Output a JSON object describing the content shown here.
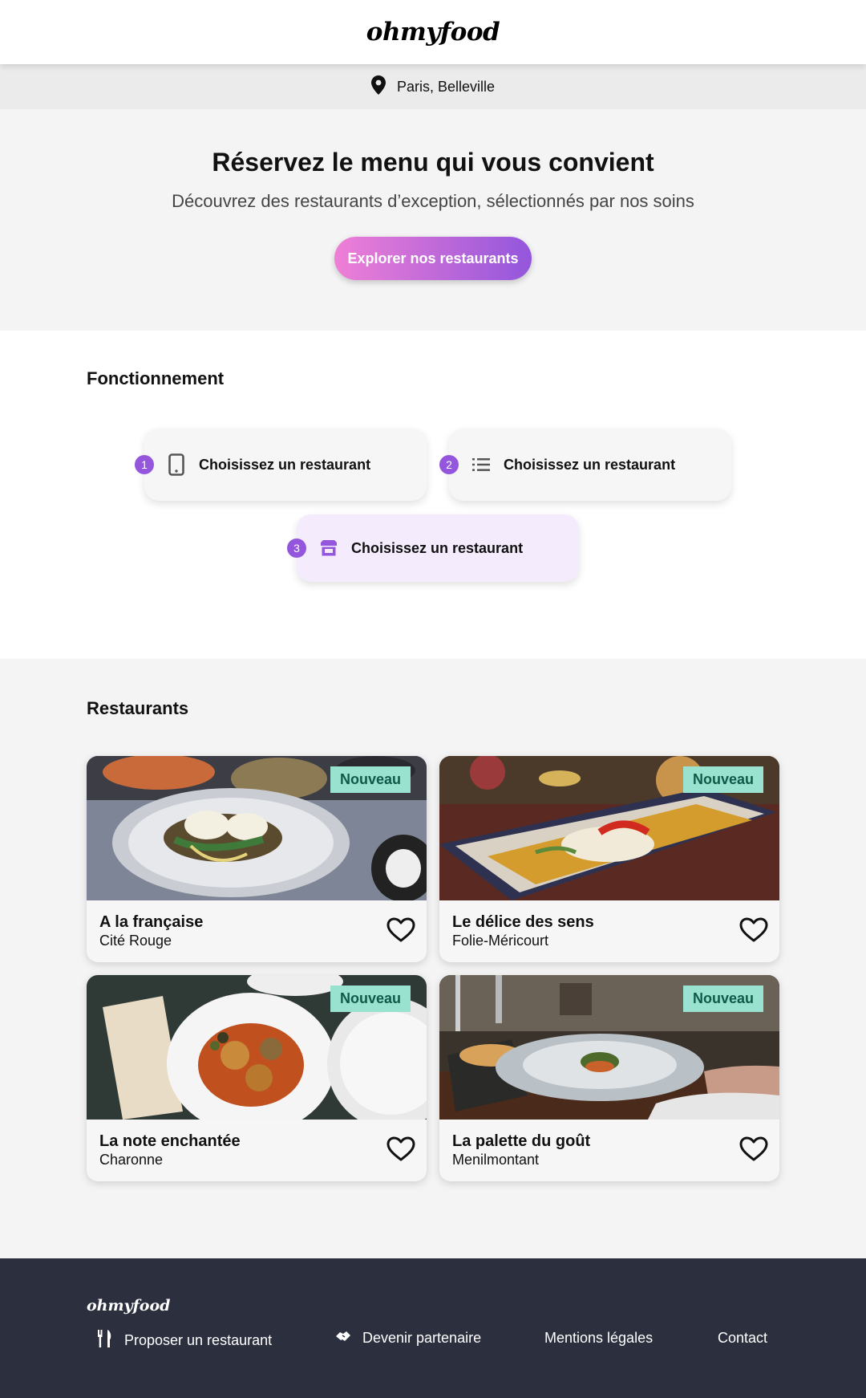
{
  "header": {
    "logo": "ohmyfood"
  },
  "location": {
    "icon": "map-pin-icon",
    "text": "Paris, Belleville"
  },
  "hero": {
    "title": "Réservez le menu qui vous convient",
    "subtitle": "Découvrez des restaurants d’exception, sélectionnés par nos soins",
    "cta_label": "Explorer nos restaurants",
    "cta_gradient": [
      "#ef7fd6",
      "#9356dc"
    ]
  },
  "how": {
    "title": "Fonctionnement",
    "steps": [
      {
        "number": "1",
        "icon": "smartphone-icon",
        "label": "Choisissez un restaurant"
      },
      {
        "number": "2",
        "icon": "list-icon",
        "label": "Choisissez un restaurant"
      },
      {
        "number": "3",
        "icon": "store-icon",
        "label": "Choisissez un restaurant"
      }
    ]
  },
  "restaurants": {
    "title": "Restaurants",
    "badge": "Nouveau",
    "items": [
      {
        "name": "A la française",
        "location": "Cité Rouge",
        "badge": "Nouveau",
        "image": "plated-eggs-dish-photo"
      },
      {
        "name": "Le délice des sens",
        "location": "Folie-Méricourt",
        "badge": "Nouveau",
        "image": "fish-platter-photo"
      },
      {
        "name": "La note enchantée",
        "location": "Charonne",
        "badge": "Nouveau",
        "image": "meatballs-plate-photo"
      },
      {
        "name": "La palette du goût",
        "location": "Menilmontant",
        "badge": "Nouveau",
        "image": "restaurant-table-photo"
      }
    ]
  },
  "footer": {
    "logo": "ohmyfood",
    "links": [
      {
        "label": "Proposer un restaurant",
        "icon": "utensils-icon"
      },
      {
        "label": "Devenir partenaire",
        "icon": "handshake-icon"
      },
      {
        "label": "Mentions légales"
      },
      {
        "label": "Contact"
      }
    ]
  },
  "colors": {
    "accent": "#9356dc",
    "badge_bg": "#99e2d0",
    "badge_text": "#0f5a49",
    "footer_bg": "#2c2f3e"
  }
}
